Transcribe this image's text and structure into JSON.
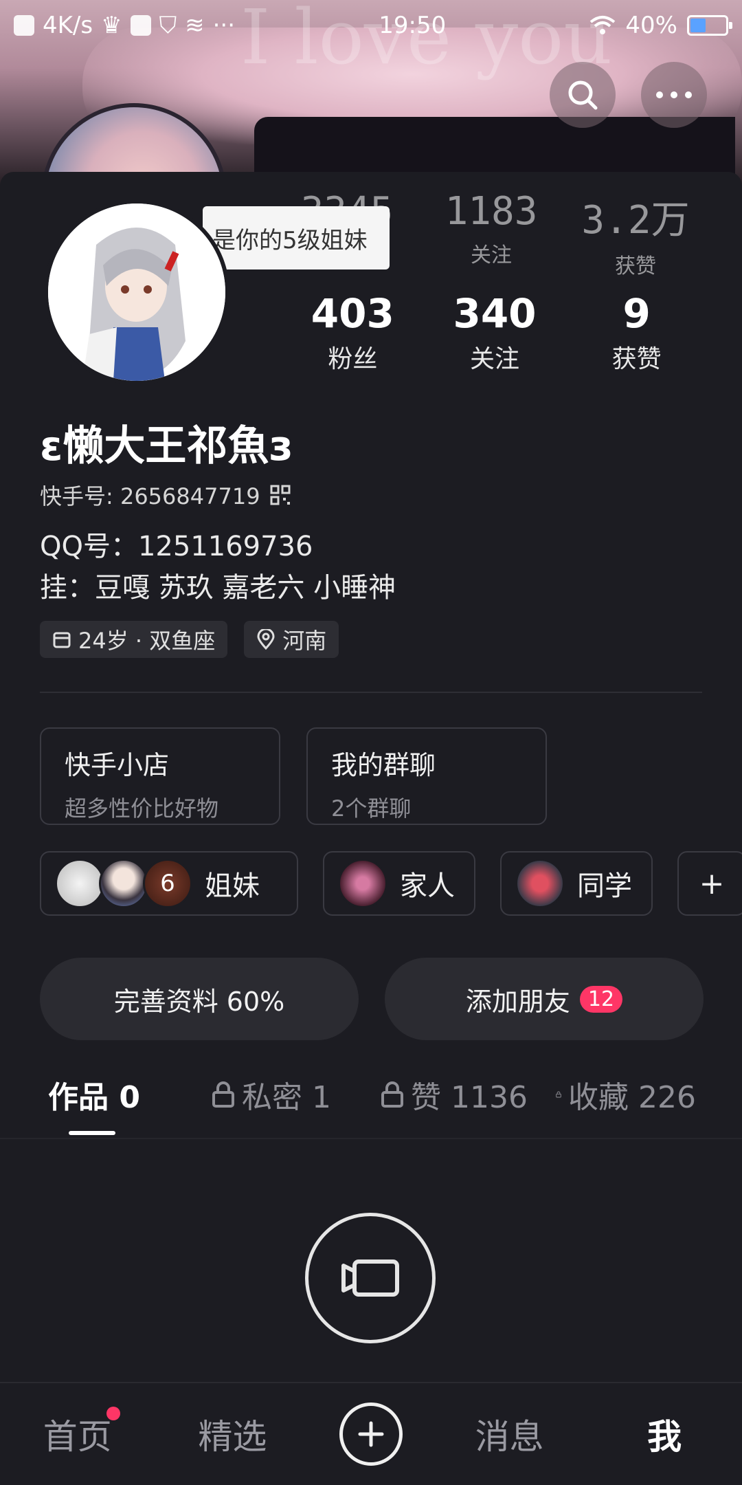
{
  "status_bar": {
    "speed": "4K/s",
    "time": "19:50",
    "battery": "40%",
    "battery_level": 0.4
  },
  "banner": {
    "bg_text": "I love you"
  },
  "tooltip": {
    "text": "是你的5级姐妹"
  },
  "ghost_stats": [
    {
      "num": "3345",
      "label": "粉丝"
    },
    {
      "num": "1183",
      "label": "关注"
    },
    {
      "num": "3.2万",
      "label": "获赞"
    }
  ],
  "stats": [
    {
      "num": "403",
      "label": "粉丝"
    },
    {
      "num": "340",
      "label": "关注"
    },
    {
      "num": "9",
      "label": "获赞"
    }
  ],
  "profile": {
    "nickname": "ε懒大王祁魚з",
    "kuaishou_id": "快手号: 2656847719",
    "qq": "QQ号：1251169736",
    "gua": "挂：豆嘎 苏玖 嘉老六  小睡神",
    "age_tag": "24岁 · 双鱼座",
    "location_tag": "河南"
  },
  "cards": [
    {
      "title": "快手小店",
      "subtitle": "超多性价比好物"
    },
    {
      "title": "我的群聊",
      "subtitle": "2个群聊"
    }
  ],
  "groups": [
    {
      "label": "姐妹",
      "extra_count": "6"
    },
    {
      "label": "家人"
    },
    {
      "label": "同学"
    }
  ],
  "group_add": "+",
  "actions": {
    "complete_profile": "完善资料 60%",
    "add_friends": "添加朋友",
    "add_friends_badge": "12"
  },
  "tabs": [
    {
      "label": "作品 0",
      "locked": false
    },
    {
      "label": "私密 1",
      "locked": true
    },
    {
      "label": "赞 1136",
      "locked": true
    },
    {
      "label": "收藏 226",
      "locked": true
    }
  ],
  "bottom_nav": {
    "home": "首页",
    "featured": "精选",
    "messages": "消息",
    "me": "我"
  },
  "colors": {
    "background": "#1c1c22",
    "accent_badge": "#fe3666"
  }
}
